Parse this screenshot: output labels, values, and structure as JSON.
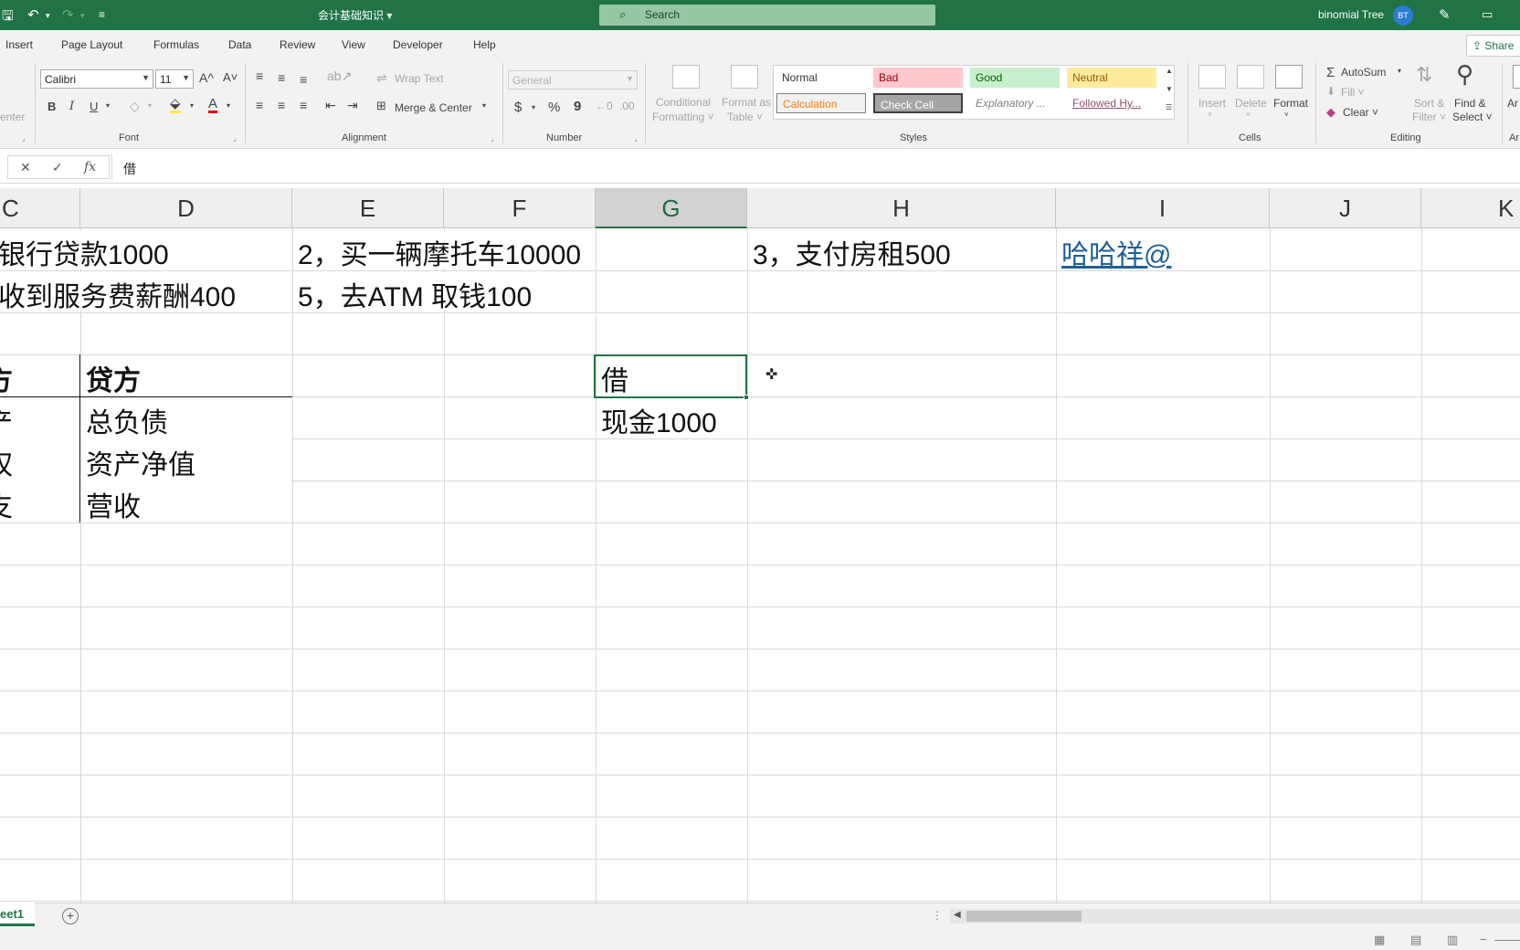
{
  "window": {
    "doc_title": "会计基础知识 ▾",
    "search_placeholder": "Search",
    "user_name": "binomial Tree",
    "user_initials": "BT"
  },
  "tabs": [
    "Insert",
    "Page Layout",
    "Formulas",
    "Data",
    "Review",
    "View",
    "Developer",
    "Help"
  ],
  "share_label": "Share",
  "ribbon": {
    "center_label": "enter",
    "font": {
      "name": "Calibri",
      "size": "11",
      "group_label": "Font",
      "grow": "A^",
      "shrink": "A˅",
      "bold": "B",
      "italic": "I",
      "underline": "U"
    },
    "alignment": {
      "wrap_text": "Wrap Text",
      "merge_center": "Merge & Center",
      "group_label": "Alignment"
    },
    "number": {
      "format": "General",
      "currency": "$",
      "percent": "%",
      "comma": "9",
      "group_label": "Number"
    },
    "styles": {
      "conditional_formatting": [
        "Conditional",
        "Formatting ˅"
      ],
      "format_as_table": [
        "Format as",
        "Table ˅"
      ],
      "cells": [
        {
          "label": "Normal",
          "bg": "#ffffff",
          "color": "#333333"
        },
        {
          "label": "Bad",
          "bg": "#ffc7ce",
          "color": "#9c0006"
        },
        {
          "label": "Good",
          "bg": "#c6efce",
          "color": "#006100"
        },
        {
          "label": "Neutral",
          "bg": "#ffeb9c",
          "color": "#9c5700"
        },
        {
          "label": "Calculation",
          "bg": "#f2f2f2",
          "color": "#fa7d00"
        },
        {
          "label": "Check Cell",
          "bg": "#a5a5a5",
          "color": "#ffffff"
        },
        {
          "label": "Explanatory ...",
          "bg": "#ffffff",
          "color": "#7f7f7f"
        },
        {
          "label": "Followed Hy...",
          "bg": "#ffffff",
          "color": "#954f72"
        }
      ],
      "group_label": "Styles"
    },
    "cells_group": {
      "insert": "Insert",
      "delete": "Delete",
      "format": "Format",
      "group_label": "Cells"
    },
    "editing": {
      "autosum": "AutoSum",
      "fill": "Fill ˅",
      "clear": "Clear ˅",
      "sort_filter": [
        "Sort &",
        "Filter ˅"
      ],
      "find_select": [
        "Find &",
        "Select ˅"
      ],
      "group_label": "Editing"
    },
    "analyze_partial": "Ar"
  },
  "formula_bar": {
    "cancel": "✕",
    "enter": "✓",
    "fx": "fx",
    "value": "借"
  },
  "columns": [
    {
      "label": "C",
      "selected": false
    },
    {
      "label": "D",
      "selected": false
    },
    {
      "label": "E",
      "selected": false
    },
    {
      "label": "F",
      "selected": false
    },
    {
      "label": "G",
      "selected": true
    },
    {
      "label": "H",
      "selected": false
    },
    {
      "label": "I",
      "selected": false
    },
    {
      "label": "J",
      "selected": false
    },
    {
      "label": "K",
      "selected": false
    }
  ],
  "cells": {
    "r1_c": "银行贷款1000",
    "r1_e": "2，买一辆摩托车10000",
    "r1_h": "3，支付房租500",
    "r1_i": "哈哈祥@",
    "r2_c": "收到服务费薪酬400",
    "r2_e": "5，去ATM 取钱100",
    "r4_c_partial": "方",
    "r4_d": "贷方",
    "r4_g": "借",
    "r5_c_partial": "产",
    "r5_d": "总负债",
    "r5_g": "现金1000",
    "r6_c_partial": "权",
    "r6_d": "资产净值",
    "r7_c_partial": "支",
    "r7_d": "营收"
  },
  "sheet": {
    "name": "eet1",
    "add": "+"
  }
}
